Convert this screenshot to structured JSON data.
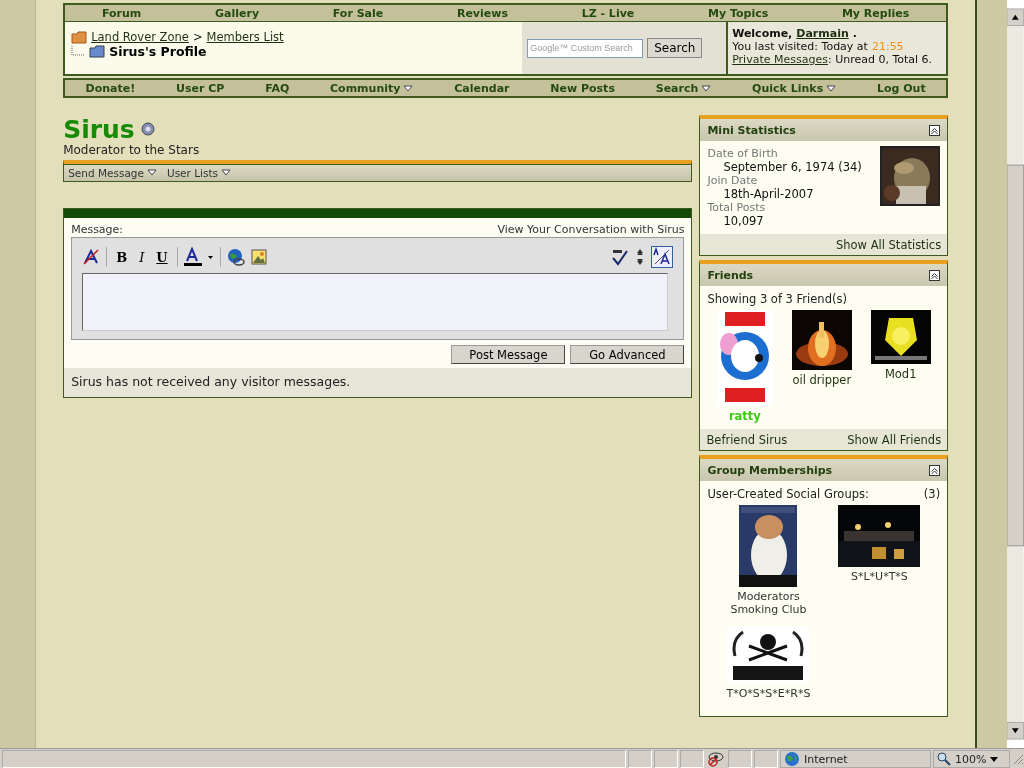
{
  "top_nav": [
    "Forum",
    "Gallery",
    "For Sale",
    "Reviews",
    "LZ - Live",
    "My Topics",
    "My Replies"
  ],
  "breadcrumb": {
    "links": [
      "Land Rover Zone",
      "Members List"
    ],
    "separator": ">",
    "current": "Sirus's Profile"
  },
  "search": {
    "placeholder": "Google™ Custom Search",
    "button": "Search"
  },
  "welcome": {
    "greeting": "Welcome,",
    "user": "Darmain",
    "end": ".",
    "last_visited": "You last visited: Today at",
    "time": "21:55",
    "pm_link": "Private Messages",
    "pm_counts": ": Unread 0, Total 6."
  },
  "second_nav": [
    {
      "label": "Donate!",
      "dropdown": false
    },
    {
      "label": "User CP",
      "dropdown": false
    },
    {
      "label": "FAQ",
      "dropdown": false
    },
    {
      "label": "Community",
      "dropdown": true
    },
    {
      "label": "Calendar",
      "dropdown": false
    },
    {
      "label": "New Posts",
      "dropdown": false
    },
    {
      "label": "Search",
      "dropdown": true
    },
    {
      "label": "Quick Links",
      "dropdown": true
    },
    {
      "label": "Log Out",
      "dropdown": false
    }
  ],
  "profile": {
    "name": "Sirus",
    "online": false,
    "title": "Moderator to the Stars",
    "actions": [
      "Send Message",
      "User Lists"
    ]
  },
  "message_form": {
    "label": "Message:",
    "conversation_link": "View Your Conversation with Sirus",
    "format_buttons": [
      "B",
      "I",
      "U"
    ],
    "wysiwyg_on": true,
    "buttons": [
      "Post Message",
      "Go Advanced"
    ],
    "note": "Sirus has not received any visitor messages."
  },
  "mini_statistics": {
    "title": "Mini Statistics",
    "stats": [
      {
        "label": "Date of Birth",
        "value": "September 6, 1974 (34)"
      },
      {
        "label": "Join Date",
        "value": "18th-April-2007"
      },
      {
        "label": "Total Posts",
        "value": "10,097"
      }
    ],
    "footer_link": "Show All Statistics"
  },
  "friends": {
    "title": "Friends",
    "summary": "Showing 3 of 3 Friend(s)",
    "items": [
      {
        "name": "ratty",
        "online": true
      },
      {
        "name": "oil dripper",
        "online": false
      },
      {
        "name": "Mod1",
        "online": false
      }
    ],
    "footer_links": [
      "Befriend Sirus",
      "Show All Friends"
    ]
  },
  "groups": {
    "title": "Group Memberships",
    "heading": "User-Created Social Groups:",
    "count": "(3)",
    "items": [
      "Moderators Smoking Club",
      "S*L*U*T*S",
      "T*O*S*S*E*R*S"
    ]
  },
  "status_bar": {
    "zone": "Internet",
    "zoom": "100%"
  }
}
